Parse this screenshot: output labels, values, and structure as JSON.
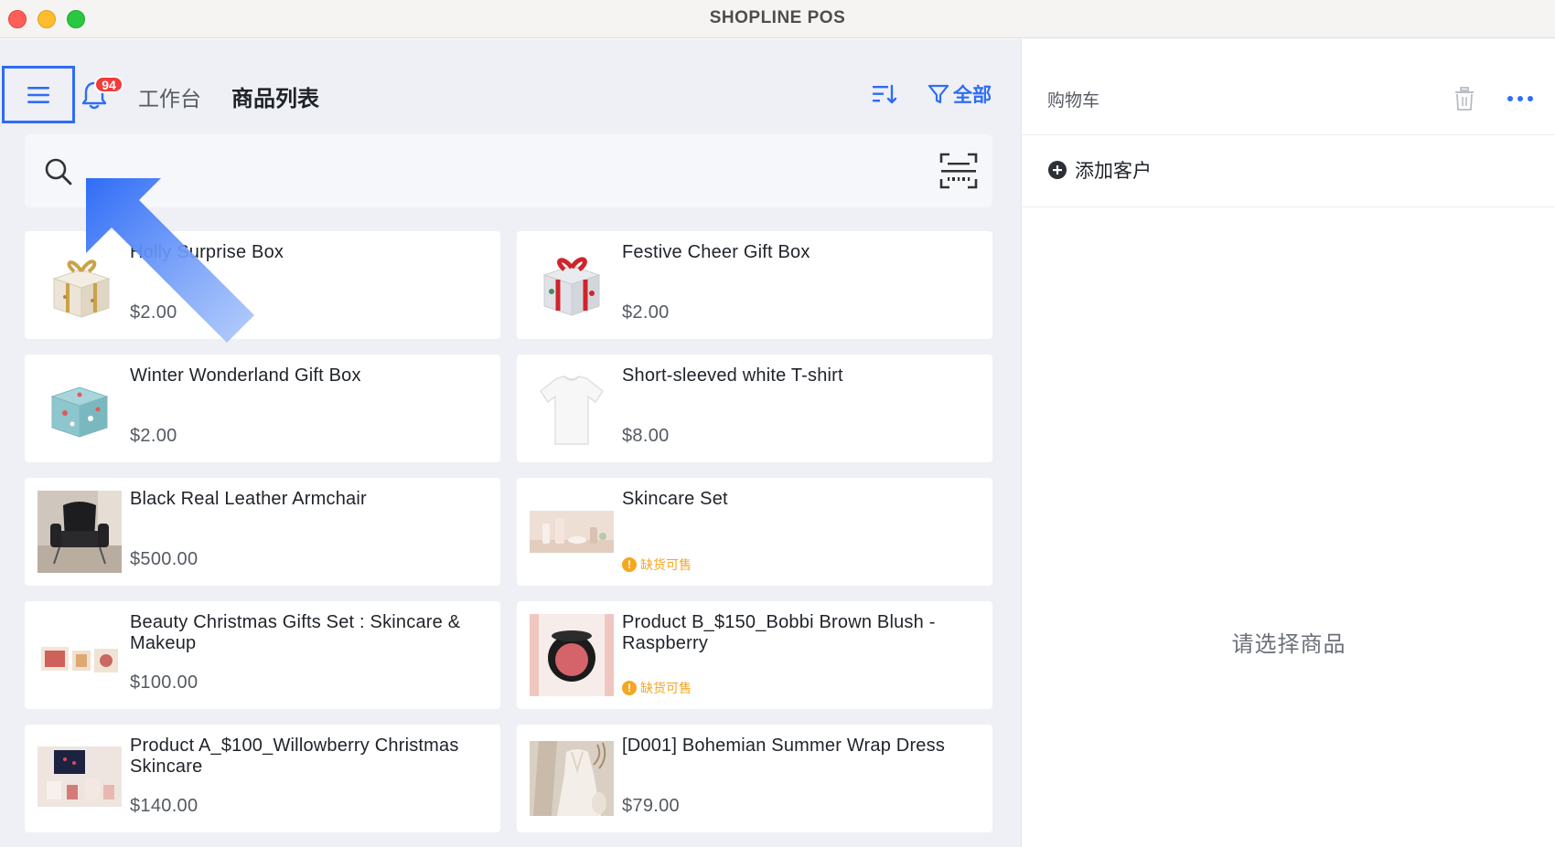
{
  "window": {
    "title": "SHOPLINE POS"
  },
  "header": {
    "notification_count": "94",
    "workbench_label": "工作台",
    "page_title": "商品列表",
    "filter_label": "全部",
    "accent_color": "#2f6cf6"
  },
  "search": {
    "placeholder": ""
  },
  "products": [
    {
      "name": "Holly        Surprise Box",
      "price": "$2.00",
      "stock": "",
      "thumb": "gift-box-gold-icon"
    },
    {
      "name": "Festive Cheer Gift Box",
      "price": "$2.00",
      "stock": "",
      "thumb": "gift-box-red-icon"
    },
    {
      "name": "Winter Wonderland Gift Box",
      "price": "$2.00",
      "stock": "",
      "thumb": "gift-box-teal-icon"
    },
    {
      "name": "Short-sleeved white T-shirt",
      "price": "$8.00",
      "stock": "",
      "thumb": "tshirt-icon"
    },
    {
      "name": "Black Real Leather Armchair",
      "price": "$500.00",
      "stock": "",
      "thumb": "armchair-photo"
    },
    {
      "name": "Skincare Set",
      "price": "",
      "stock": "缺货可售",
      "thumb": "skincare-set-photo"
    },
    {
      "name": "Beauty Christmas Gifts Set : Skincare & Makeup",
      "price": "$100.00",
      "stock": "",
      "thumb": "beauty-gift-set-photo"
    },
    {
      "name": "Product B_$150_Bobbi Brown Blush - Raspberry",
      "price": "",
      "stock": "缺货可售",
      "thumb": "blush-compact-photo"
    },
    {
      "name": "Product A_$100_Willowberry Christmas Skincare",
      "price": "$140.00",
      "stock": "",
      "thumb": "willowberry-photo"
    },
    {
      "name": "[D001] Bohemian Summer Wrap Dress",
      "price": "$79.00",
      "stock": "",
      "thumb": "wrap-dress-photo"
    }
  ],
  "cart": {
    "title": "购物车",
    "add_customer_label": "添加客户",
    "empty_hint": "请选择商品"
  }
}
